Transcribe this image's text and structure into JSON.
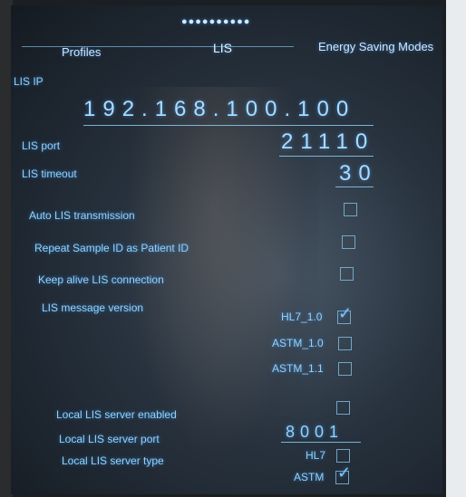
{
  "pager_dots": "●●●●●●●●●●",
  "tabs": {
    "profiles": "Profiles",
    "lis": "LIS",
    "energy": "Energy Saving Modes"
  },
  "fields": {
    "lis_ip_label": "LIS IP",
    "lis_ip_value": "192.168.100.100",
    "lis_port_label": "LIS port",
    "lis_port_value": "21110",
    "lis_timeout_label": "LIS timeout",
    "lis_timeout_value": "30"
  },
  "options": {
    "auto_transmission": "Auto LIS transmission",
    "repeat_sample_id": "Repeat Sample ID as Patient ID",
    "keep_alive": "Keep alive LIS connection",
    "message_version": "LIS message version"
  },
  "versions": [
    "HL7_1.0",
    "ASTM_1.0",
    "ASTM_1.1"
  ],
  "local": {
    "enabled_label": "Local LIS server enabled",
    "port_label": "Local LIS server port",
    "port_value": "8001",
    "type_label": "Local LIS server type",
    "types": [
      "HL7",
      "ASTM"
    ]
  },
  "checkmark": "✓"
}
